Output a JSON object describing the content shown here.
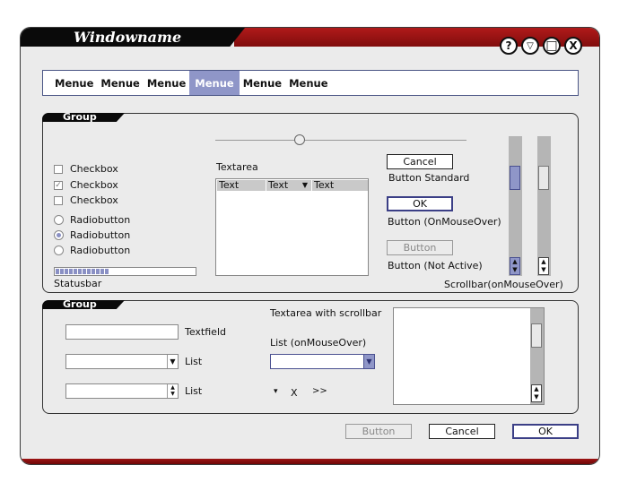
{
  "window": {
    "title": "Windowname",
    "controls": [
      "?",
      "▽",
      "□",
      "X"
    ]
  },
  "menubar": {
    "items": [
      "Menue",
      "Menue",
      "Menue",
      "Menue",
      "Menue",
      "Menue"
    ],
    "active_index": 3
  },
  "group1": {
    "label": "Group",
    "checkboxes": [
      {
        "label": "Checkbox",
        "checked": false
      },
      {
        "label": "Checkbox",
        "checked": true
      },
      {
        "label": "Checkbox",
        "checked": false
      }
    ],
    "radios": [
      {
        "label": "Radiobutton",
        "selected": false
      },
      {
        "label": "Radiobutton",
        "selected": true
      },
      {
        "label": "Radiobutton",
        "selected": false
      }
    ],
    "statusbar_label": "Statusbar",
    "statusbar_progress": 0.38,
    "slider_value": 0.33,
    "textarea_label": "Textarea",
    "textarea_columns": [
      "Text",
      "Text",
      "Text"
    ],
    "buttons": {
      "cancel": "Cancel",
      "standard_label": "Button Standard",
      "ok": "OK",
      "mouseover_label": "Button (OnMouseOver)",
      "inactive": "Button",
      "inactive_label": "Button (Not Active)"
    },
    "scrollbar_label": "Scrollbar(onMouseOver)"
  },
  "group2": {
    "label": "Group",
    "textfield_label": "Textfield",
    "list_label_1": "List",
    "list_label_2": "List",
    "textarea_scroll_label": "Textarea with scrollbar",
    "list_mouseover_label": "List (onMouseOver)",
    "icons": [
      "▾",
      "X",
      ">>"
    ]
  },
  "footer": {
    "button_inactive": "Button",
    "cancel": "Cancel",
    "ok": "OK"
  },
  "colors": {
    "title_red": "#9e1414",
    "accent_blue": "#8f96c8",
    "window_bg": "#ebebeb"
  }
}
